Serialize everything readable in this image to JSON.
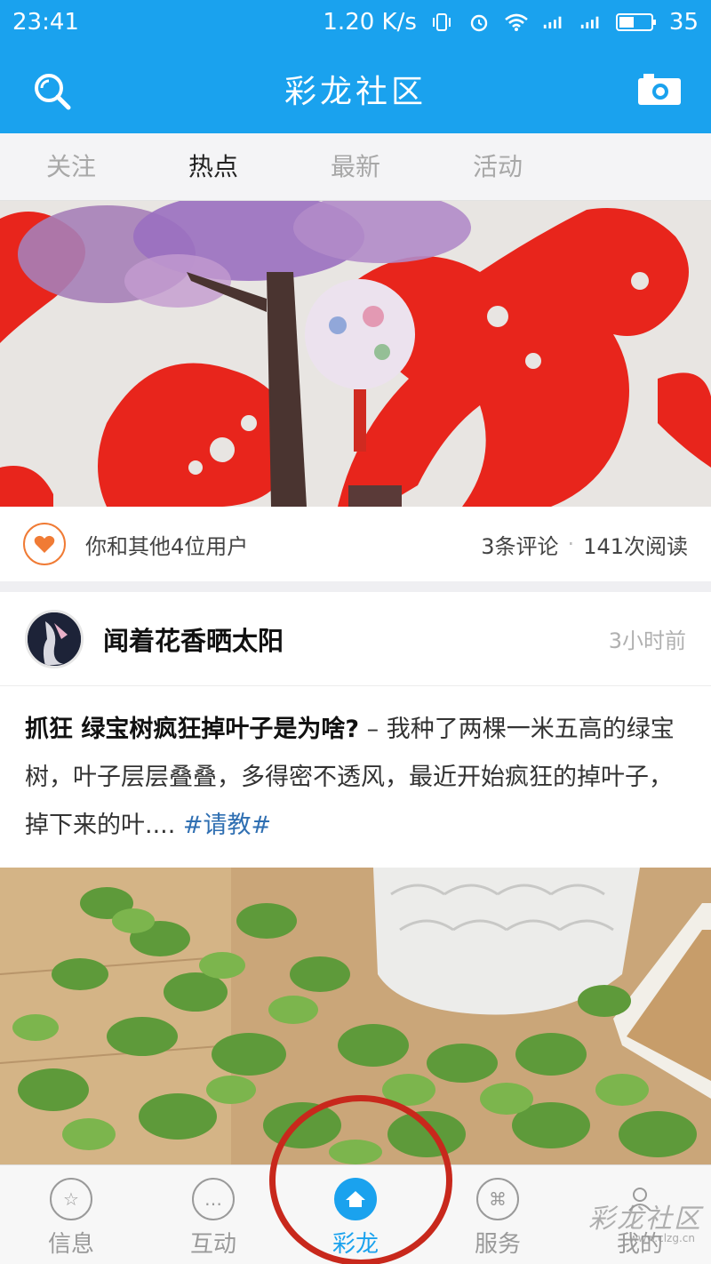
{
  "status": {
    "time": "23:41",
    "speed": "1.20 K/s",
    "battery": "35"
  },
  "header": {
    "title": "彩龙社区",
    "left_icon": "search-icon",
    "right_icon": "camera-icon",
    "accent_color": "#1aa2ee"
  },
  "tabs": [
    {
      "label": "关注",
      "active": false
    },
    {
      "label": "热点",
      "active": true
    },
    {
      "label": "最新",
      "active": false
    },
    {
      "label": "活动",
      "active": false
    }
  ],
  "feature": {
    "like_text": "你和其他4位用户",
    "comments": "3条评论",
    "reads": "141次阅读",
    "separator": "·"
  },
  "post": {
    "username": "闻着花香晒太阳",
    "time": "3小时前",
    "title": "抓狂 绿宝树疯狂掉叶子是为啥?",
    "body": " – 我种了两棵一米五高的绿宝树，叶子层层叠叠，多得密不透风，最近开始疯狂的掉叶子，掉下来的叶.... ",
    "tag": "#请教#"
  },
  "bottom_nav": [
    {
      "label": "信息",
      "icon": "star-icon",
      "active": false
    },
    {
      "label": "互动",
      "icon": "chat-icon",
      "active": false
    },
    {
      "label": "彩龙",
      "icon": "home-icon",
      "active": true
    },
    {
      "label": "服务",
      "icon": "grid-icon",
      "active": false
    },
    {
      "label": "我的",
      "icon": "user-icon",
      "active": false
    }
  ],
  "watermark": {
    "text": "彩龙社区",
    "url": "www.clzg.cn"
  }
}
